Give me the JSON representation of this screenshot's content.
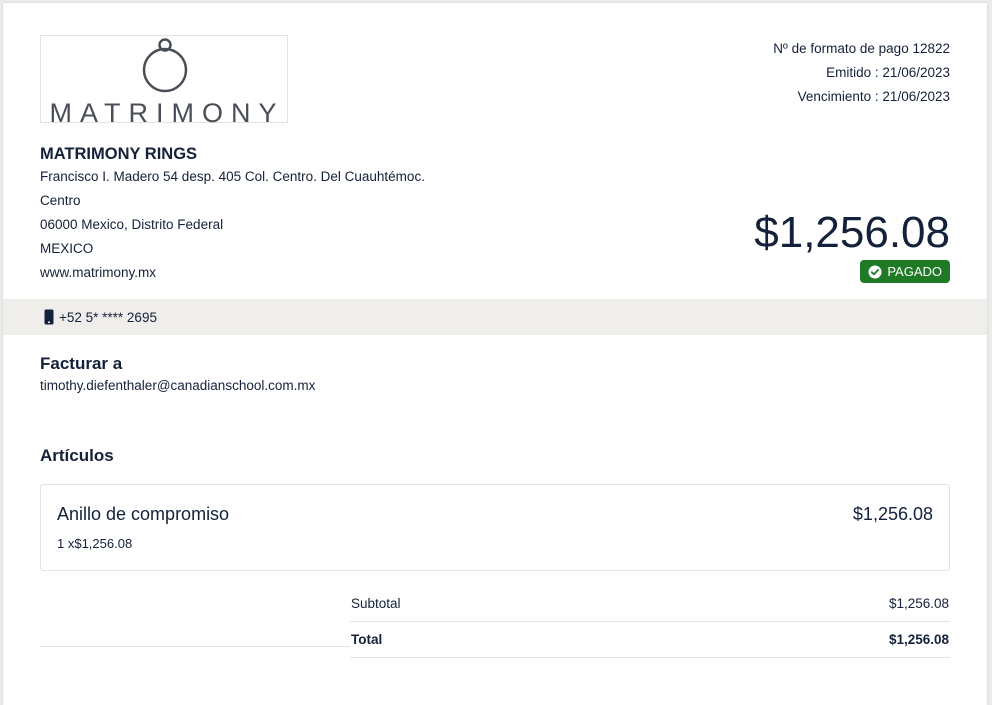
{
  "logo": {
    "wordmark": "MATRIMONY"
  },
  "meta": {
    "payment_number": "Nº de formato de pago 12822",
    "issued": "Emitido : 21/06/2023",
    "due": "Vencimiento : 21/06/2023"
  },
  "company": {
    "name": "MATRIMONY RINGS",
    "address_line1": "Francisco I. Madero 54 desp. 405 Col. Centro. Del Cuauhtémoc.",
    "address_line2": "Centro",
    "address_line3": "06000 Mexico, Distrito Federal",
    "country": "MEXICO",
    "website": "www.matrimony.mx"
  },
  "amount": "$1,256.08",
  "status": {
    "label": "PAGADO",
    "color": "#1e7a25"
  },
  "phone": "+52 5* **** 2695",
  "bill_to": {
    "title": "Facturar a",
    "email": "timothy.diefenthaler@canadianschool.com.mx"
  },
  "items": {
    "title": "Artículos",
    "list": [
      {
        "name": "Anillo de compromiso",
        "price": "$1,256.08",
        "qty": "1 x$1,256.08"
      }
    ]
  },
  "totals": {
    "subtotal_label": "Subtotal",
    "subtotal_value": "$1,256.08",
    "total_label": "Total",
    "total_value": "$1,256.08"
  }
}
